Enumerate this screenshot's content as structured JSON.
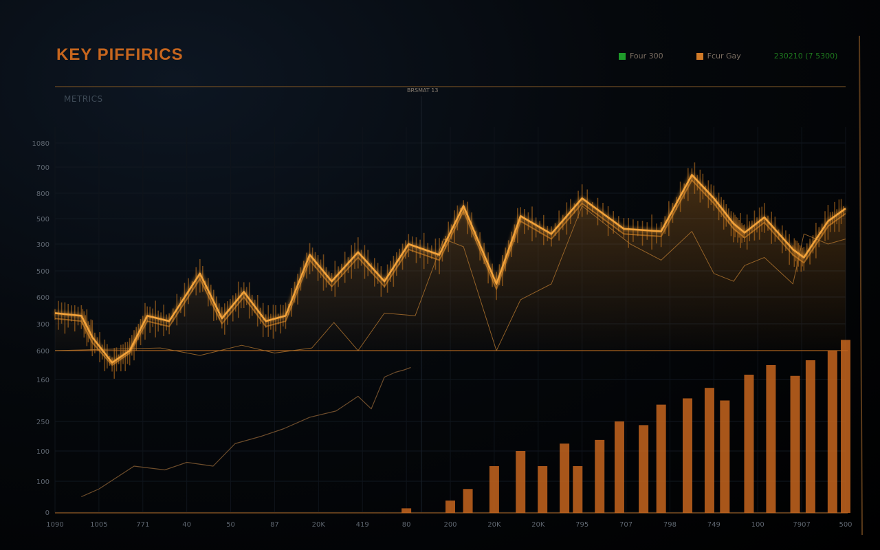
{
  "chart_data": {
    "type": "line",
    "title": "KEY PIFFIRICS",
    "subtitle": "METRICS",
    "center_label": "BRSMAT 13",
    "legend": [
      {
        "label": "Four 300",
        "color": "#1e9a2a"
      },
      {
        "label": "Fcur Gay",
        "color": "#d07a28"
      }
    ],
    "range_text": "230210 (7 5300)",
    "y_ticks": [
      {
        "label": "1080",
        "value": 1080
      },
      {
        "label": "700",
        "value": 1000
      },
      {
        "label": "800",
        "value": 900
      },
      {
        "label": "500",
        "value": 800
      },
      {
        "label": "300",
        "value": 700
      },
      {
        "label": "500",
        "value": 600
      },
      {
        "label": "600",
        "value": 500
      },
      {
        "label": "300",
        "value": 400
      },
      {
        "label": "600",
        "value": 300
      },
      {
        "label": "160",
        "value": 180
      },
      {
        "label": "250",
        "value": 80
      },
      {
        "label": "100",
        "value": 40
      },
      {
        "label": "100",
        "value": 0
      },
      {
        "label": "0",
        "value": -40
      }
    ],
    "x_ticks": [
      {
        "label": "1090",
        "x": 0
      },
      {
        "label": "1005",
        "x": 1
      },
      {
        "label": "771",
        "x": 2
      },
      {
        "label": "40",
        "x": 3
      },
      {
        "label": "50",
        "x": 4
      },
      {
        "label": "87",
        "x": 5
      },
      {
        "label": "20K",
        "x": 6
      },
      {
        "label": "419",
        "x": 7
      },
      {
        "label": "80",
        "x": 8
      },
      {
        "label": "200",
        "x": 9
      },
      {
        "label": "20K",
        "x": 10
      },
      {
        "label": "20K",
        "x": 11
      },
      {
        "label": "795",
        "x": 12
      },
      {
        "label": "707",
        "x": 13
      },
      {
        "label": "798",
        "x": 14
      },
      {
        "label": "749",
        "x": 15
      },
      {
        "label": "100",
        "x": 16
      },
      {
        "label": "7907",
        "x": 17
      },
      {
        "label": "500",
        "x": 18
      }
    ],
    "xlim": [
      0,
      18
    ],
    "ylim": [
      -40,
      1080
    ],
    "baseline_value": 300,
    "series": [
      {
        "role": "main",
        "color": "#f3a33a",
        "x": [
          0,
          0.6,
          0.85,
          1.3,
          1.7,
          2.1,
          2.6,
          3.3,
          3.8,
          4.3,
          4.8,
          5.25,
          5.8,
          6.3,
          6.9,
          7.5,
          8.05,
          8.75,
          9.3,
          10.05,
          10.6,
          11.3,
          12.0,
          12.95,
          13.8,
          14.5,
          15.0,
          15.45,
          15.7,
          16.15,
          16.8,
          17.05,
          17.6,
          18.0
        ],
        "y": [
          440,
          430,
          350,
          250,
          300,
          430,
          410,
          590,
          420,
          520,
          410,
          430,
          660,
          560,
          670,
          560,
          700,
          660,
          850,
          550,
          810,
          740,
          880,
          760,
          750,
          970,
          880,
          780,
          745,
          805,
          680,
          650,
          790,
          840
        ]
      },
      {
        "role": "band",
        "color": "#e8902a",
        "x": [
          0,
          0.6,
          0.85,
          1.3,
          1.7,
          2.1,
          2.6,
          3.3,
          3.8,
          4.3,
          4.8,
          5.25,
          5.8,
          6.3,
          6.9,
          7.5,
          8.05,
          8.75,
          9.3,
          10.05,
          10.6,
          11.3,
          12.0,
          12.95,
          13.8,
          14.5,
          15.0,
          15.45,
          15.7,
          16.15,
          16.8,
          17.05,
          17.6,
          18.0
        ],
        "y": [
          420,
          410,
          330,
          240,
          290,
          410,
          390,
          570,
          400,
          500,
          390,
          410,
          640,
          540,
          650,
          540,
          680,
          640,
          830,
          530,
          790,
          720,
          860,
          740,
          730,
          950,
          860,
          760,
          725,
          785,
          660,
          630,
          770,
          820
        ]
      },
      {
        "role": "thin-upper",
        "color": "#b0742e",
        "x": [
          0,
          2.4,
          3.3,
          4.25,
          5.0,
          5.85,
          6.35,
          6.9,
          7.5,
          8.2,
          8.85,
          9.3,
          10.05,
          10.6,
          11.3,
          12.0,
          13.1,
          13.8,
          14.5,
          15.0,
          15.45,
          15.7,
          16.15,
          16.8,
          17.05,
          17.6,
          18.0
        ],
        "y": [
          300,
          310,
          280,
          320,
          290,
          310,
          405,
          300,
          440,
          430,
          720,
          690,
          300,
          490,
          550,
          850,
          700,
          640,
          750,
          590,
          560,
          620,
          650,
          550,
          740,
          700,
          720
        ]
      },
      {
        "role": "thin-lower",
        "color": "#7a5530",
        "x": [
          0.6,
          1.0,
          1.8,
          2.5,
          3.0,
          3.6,
          4.1,
          4.7,
          5.2,
          5.8,
          6.4,
          6.9,
          7.2,
          7.5,
          7.75,
          7.95,
          8.1
        ],
        "y": [
          -20,
          -10,
          20,
          15,
          25,
          20,
          50,
          60,
          70,
          90,
          105,
          140,
          110,
          190,
          210,
          220,
          230
        ]
      }
    ],
    "bars": {
      "color": "#c6651e",
      "x": [
        8.0,
        9.0,
        9.4,
        10.0,
        10.6,
        11.1,
        11.6,
        11.9,
        12.4,
        12.85,
        13.4,
        13.8,
        14.4,
        14.9,
        15.25,
        15.8,
        16.3,
        16.85,
        17.2,
        17.7,
        18.0
      ],
      "y": [
        -35,
        -25,
        -10,
        20,
        40,
        20,
        50,
        20,
        55,
        80,
        75,
        120,
        135,
        160,
        130,
        200,
        240,
        195,
        260,
        300,
        340
      ]
    }
  }
}
